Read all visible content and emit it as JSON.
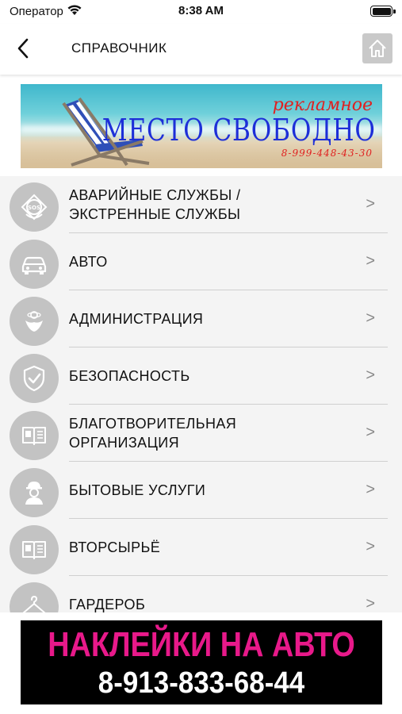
{
  "status_bar": {
    "carrier": "Оператор",
    "time": "8:38 AM"
  },
  "nav": {
    "title": "СПРАВОЧНИК",
    "back_icon": "chevron-left-icon",
    "home_icon": "home-icon",
    "home_button_color": "#c9c9c9"
  },
  "ad_top": {
    "line1": "рекламное",
    "line2": "МЕСТО СВОБОДНО",
    "phone": "8-999-448-43-30"
  },
  "list": {
    "items": [
      {
        "label": "АВАРИЙНЫЕ СЛУЖБЫ /\nЭКСТРЕННЫЕ СЛУЖБЫ",
        "icon": "sos-icon",
        "chevron": ">"
      },
      {
        "label": "АВТО",
        "icon": "car-icon",
        "chevron": ">"
      },
      {
        "label": "АДМИНИСТРАЦИЯ",
        "icon": "emblem-icon",
        "chevron": ">"
      },
      {
        "label": "БЕЗОПАСНОСТЬ",
        "icon": "shield-check-icon",
        "chevron": ">"
      },
      {
        "label": "БЛАГОТВОРИТЕЛЬНАЯ\nОРГАНИЗАЦИЯ",
        "icon": "book-icon",
        "chevron": ">"
      },
      {
        "label": "БЫТОВЫЕ УСЛУГИ",
        "icon": "worker-icon",
        "chevron": ">"
      },
      {
        "label": "ВТОРСЫРЬЁ",
        "icon": "book-icon",
        "chevron": ">"
      },
      {
        "label": "ГАРДЕРОБ",
        "icon": "hanger-icon",
        "chevron": ">"
      }
    ],
    "icon_bg_color": "#c3c3c3"
  },
  "ad_bottom": {
    "line1": "НАКЛЕЙКИ НА АВТО",
    "line2": "8-913-833-68-44",
    "line1_color": "#e8198a"
  }
}
